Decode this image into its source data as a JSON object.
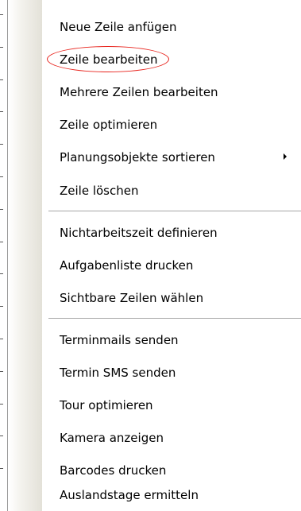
{
  "menu": {
    "items": [
      {
        "label": "Neue Zeile anfügen"
      },
      {
        "label": "Zeile bearbeiten",
        "highlighted": true
      },
      {
        "label": "Mehrere Zeilen bearbeiten"
      },
      {
        "label": "Zeile optimieren"
      },
      {
        "label": "Planungsobjekte sortieren",
        "has_submenu": true
      },
      {
        "label": "Zeile löschen"
      },
      {
        "label": "Nichtarbeitszeit definieren"
      },
      {
        "label": "Aufgabenliste drucken"
      },
      {
        "label": "Sichtbare Zeilen wählen"
      },
      {
        "label": "Terminmails senden"
      },
      {
        "label": "Termin SMS senden"
      },
      {
        "label": "Tour optimieren"
      },
      {
        "label": "Kamera anzeigen"
      },
      {
        "label": "Barcodes drucken"
      },
      {
        "label": "Auslandstage ermitteln"
      }
    ]
  },
  "colors": {
    "highlight_ellipse": "#e8231c",
    "separator": "#a6a6a6",
    "text": "#000000"
  },
  "icons": {
    "submenu": "triangle-right-icon"
  }
}
